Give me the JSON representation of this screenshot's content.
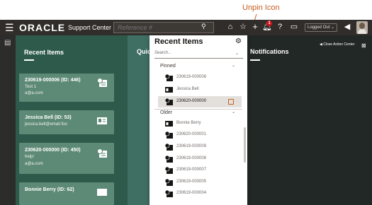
{
  "annotation": {
    "label": "Unpin Icon"
  },
  "topbar": {
    "brand": "ORACLE",
    "product": "Support Center",
    "search_placeholder": "Reference #",
    "notification_count": "1",
    "status": "Logged Out"
  },
  "recent_panel": {
    "title": "Recent Items",
    "cards": [
      {
        "line1": "230619-000006 (ID: 446)",
        "line2": "Test 1",
        "line3": "a@a.com"
      },
      {
        "line1": "Jessica Bell (ID: 53)",
        "line2": "jessica.bell@email.foo"
      },
      {
        "line1": "230620-000000 (ID: 450)",
        "line2": "help!",
        "line3": "a@a.com"
      },
      {
        "line1": "Bonnie Berry (ID: 62)"
      }
    ]
  },
  "quick_panel": {
    "title": "Quic"
  },
  "notifications": {
    "title": "Notifications",
    "close_label": "Close Action Center"
  },
  "dropdown": {
    "title": "Recent Items",
    "search_placeholder": "Search...",
    "pinned_label": "Pinned",
    "older_label": "Older",
    "pinned": [
      {
        "text": "230619-000006",
        "icon": "incident-icon"
      },
      {
        "text": "Jessica Bell",
        "icon": "contact-card-icon"
      },
      {
        "text": "230620-000000",
        "icon": "incident-icon",
        "highlighted": true
      }
    ],
    "older": [
      {
        "text": "Bonnie Berry",
        "icon": "contact-card-icon"
      },
      {
        "text": "230620-000001",
        "icon": "incident-icon"
      },
      {
        "text": "230619-000009",
        "icon": "incident-icon"
      },
      {
        "text": "230619-000008",
        "icon": "incident-icon"
      },
      {
        "text": "230619-000007",
        "icon": "incident-icon"
      },
      {
        "text": "230619-000005",
        "icon": "incident-icon"
      },
      {
        "text": "230619-000004",
        "icon": "incident-icon"
      }
    ]
  },
  "colors": {
    "topbar": "#312d2a",
    "recent_panel": "#2e5a4b",
    "card": "#5d8a76",
    "quick_panel": "#3f6f63",
    "callout": "#c75d1e",
    "badge": "#d1101b"
  }
}
